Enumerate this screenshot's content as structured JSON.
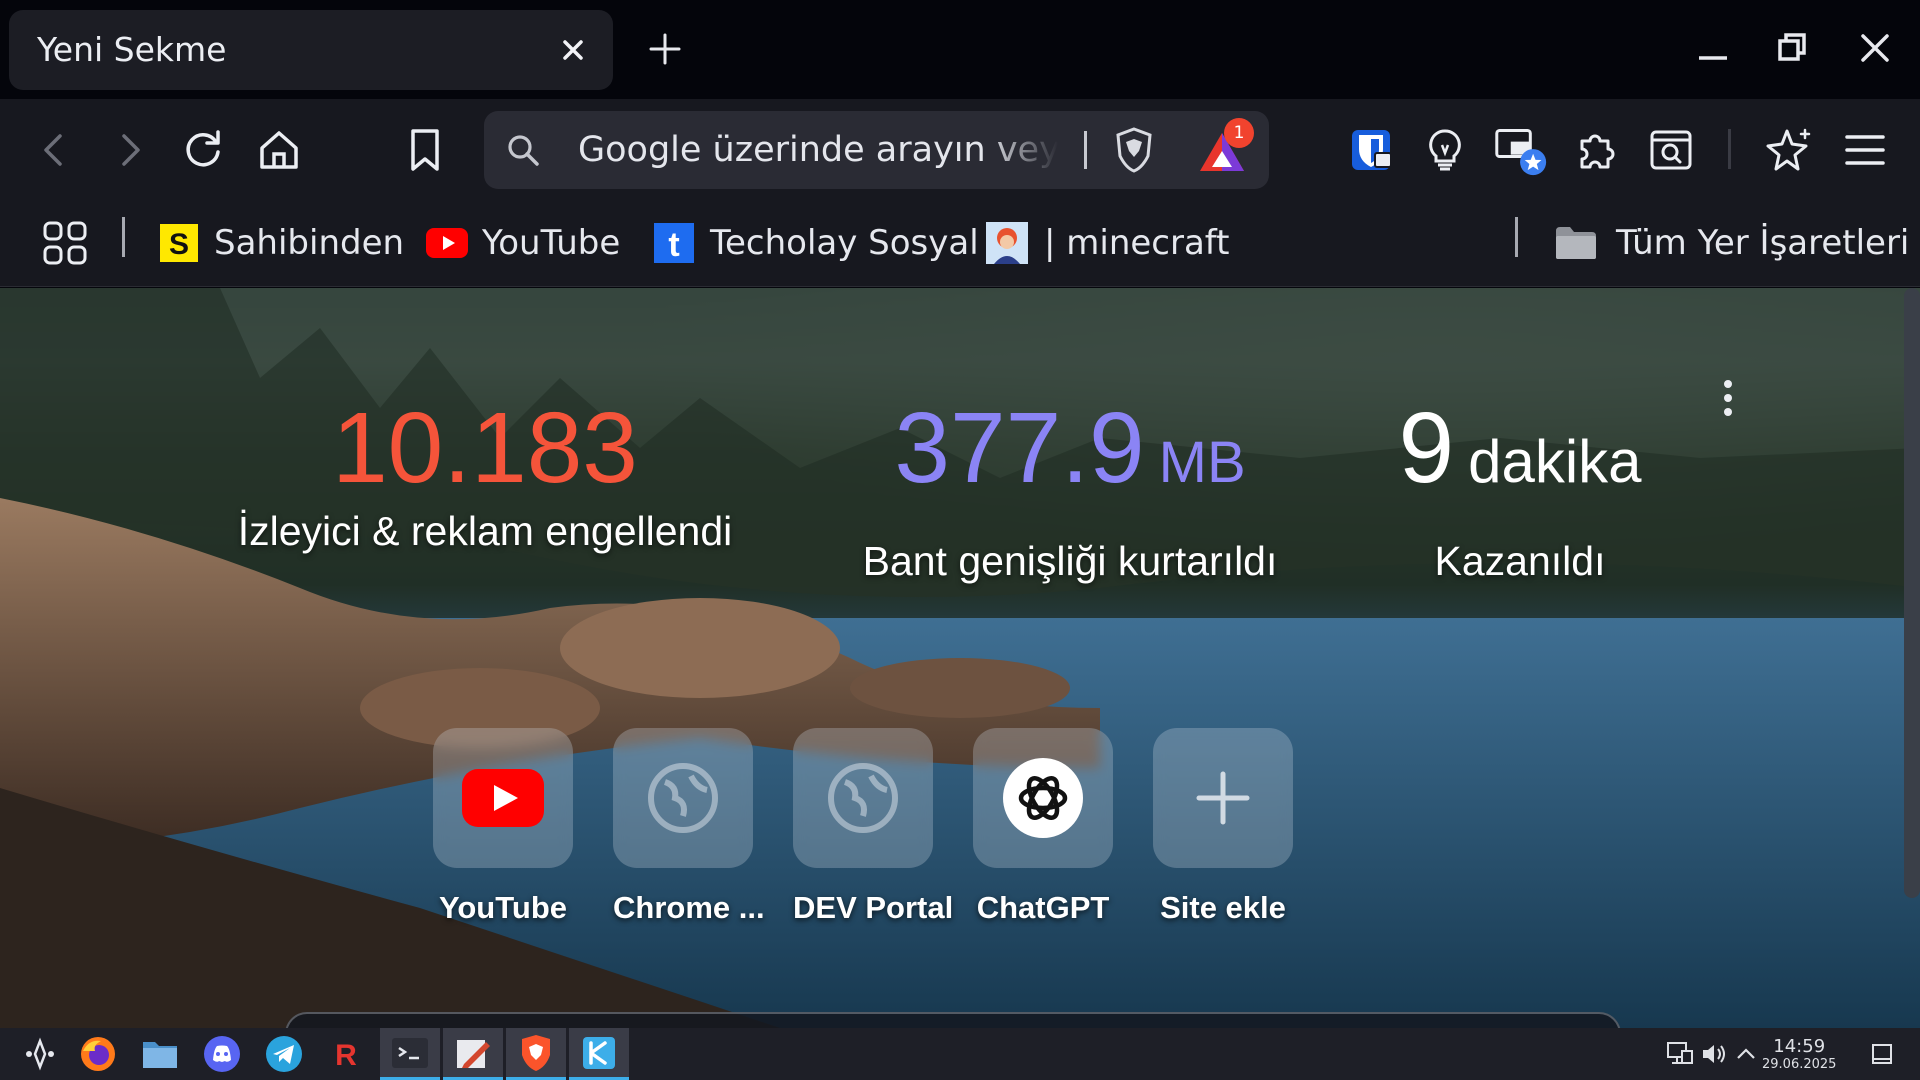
{
  "tab": {
    "title": "Yeni Sekme"
  },
  "omnibox": {
    "placeholder": "Google üzerinde arayın veya URL yazın",
    "rewards_badge": "1"
  },
  "bookmarks": {
    "items": [
      {
        "label": "Sahibinden",
        "icon": "sahibinden-icon"
      },
      {
        "label": "YouTube",
        "icon": "youtube-icon"
      },
      {
        "label": "Techolay Sosyal",
        "icon": "techolay-icon"
      },
      {
        "label": "| minecraft",
        "icon": "avatar-icon"
      }
    ],
    "all_bookmarks": "Tüm Yer İşaretleri"
  },
  "stats": {
    "trackers": {
      "value": "10.183",
      "caption": "İzleyici & reklam engellendi",
      "color": "#f5543a"
    },
    "bandwidth": {
      "value": "377.9",
      "unit": "MB",
      "caption": "Bant genişliği kurtarıldı",
      "color": "#8b84f5"
    },
    "time": {
      "value": "9",
      "unit": "dakika",
      "caption": "Kazanıldı",
      "color": "#ffffff"
    }
  },
  "tiles": [
    {
      "label": "YouTube",
      "icon": "youtube-icon"
    },
    {
      "label": "Chrome ...",
      "icon": "globe-icon"
    },
    {
      "label": "DEV Portal",
      "icon": "globe-icon"
    },
    {
      "label": "ChatGPT",
      "icon": "chatgpt-icon"
    },
    {
      "label": "Site ekle",
      "icon": "plus-icon"
    }
  ],
  "taskbar": {
    "apps": [
      "launcher-icon",
      "firefox-icon",
      "files-icon",
      "discord-icon",
      "telegram-icon",
      "r-app-icon",
      "terminal-icon",
      "editor-icon",
      "brave-icon",
      "kde-connect-icon"
    ],
    "time": "14:59",
    "date": "29.06.2025"
  },
  "colors": {
    "accent": "#3daee9",
    "tab_bg": "#1c1d24",
    "toolbar_bg": "#17181f"
  }
}
